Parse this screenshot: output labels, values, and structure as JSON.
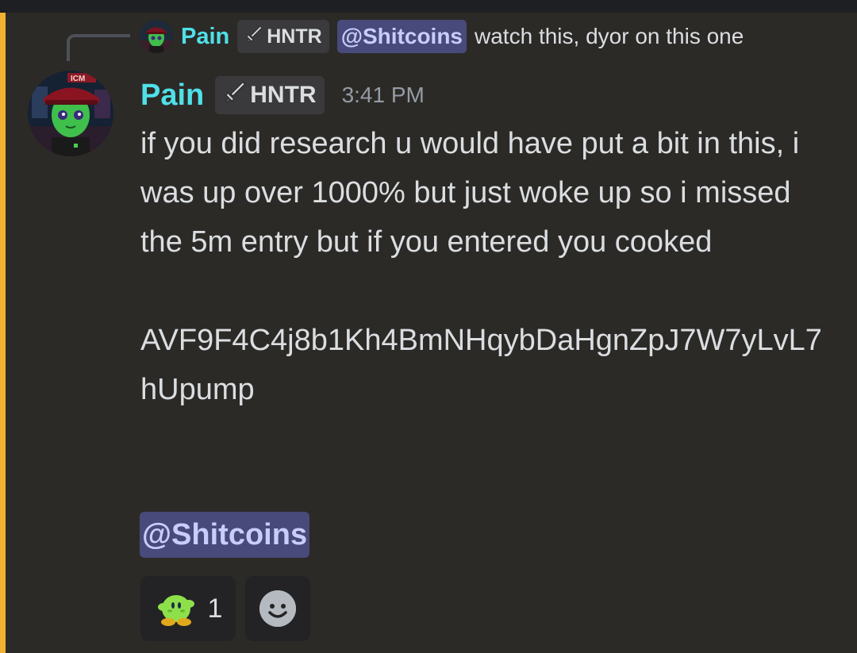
{
  "reply": {
    "author": "Pain",
    "role_tag": "HNTR",
    "mention": "@Shitcoins",
    "text": "watch this, dyor on this one"
  },
  "message": {
    "author": "Pain",
    "role_tag": "HNTR",
    "timestamp": "3:41 PM",
    "paragraphs": [
      "if you did research u would have put a bit in this, i was up over 1000% but just woke up so i missed the 5m entry but if you entered you cooked",
      "AVF9F4C4j8b1Kh4BmNHqybDaHgnZpJ7W7yLvL7hUpump"
    ],
    "mention": "@Shitcoins"
  },
  "reactions": [
    {
      "emoji": "green-kirby-emoji",
      "count": "1"
    }
  ],
  "colors": {
    "username": "#4fe0e8",
    "mention_highlight": "#f0b132",
    "mention_bg": "#474a7a",
    "background": "#2c2a27"
  },
  "icons": {
    "role_tag_icon": "sword-icon",
    "add_reaction_icon": "smiley-icon"
  }
}
